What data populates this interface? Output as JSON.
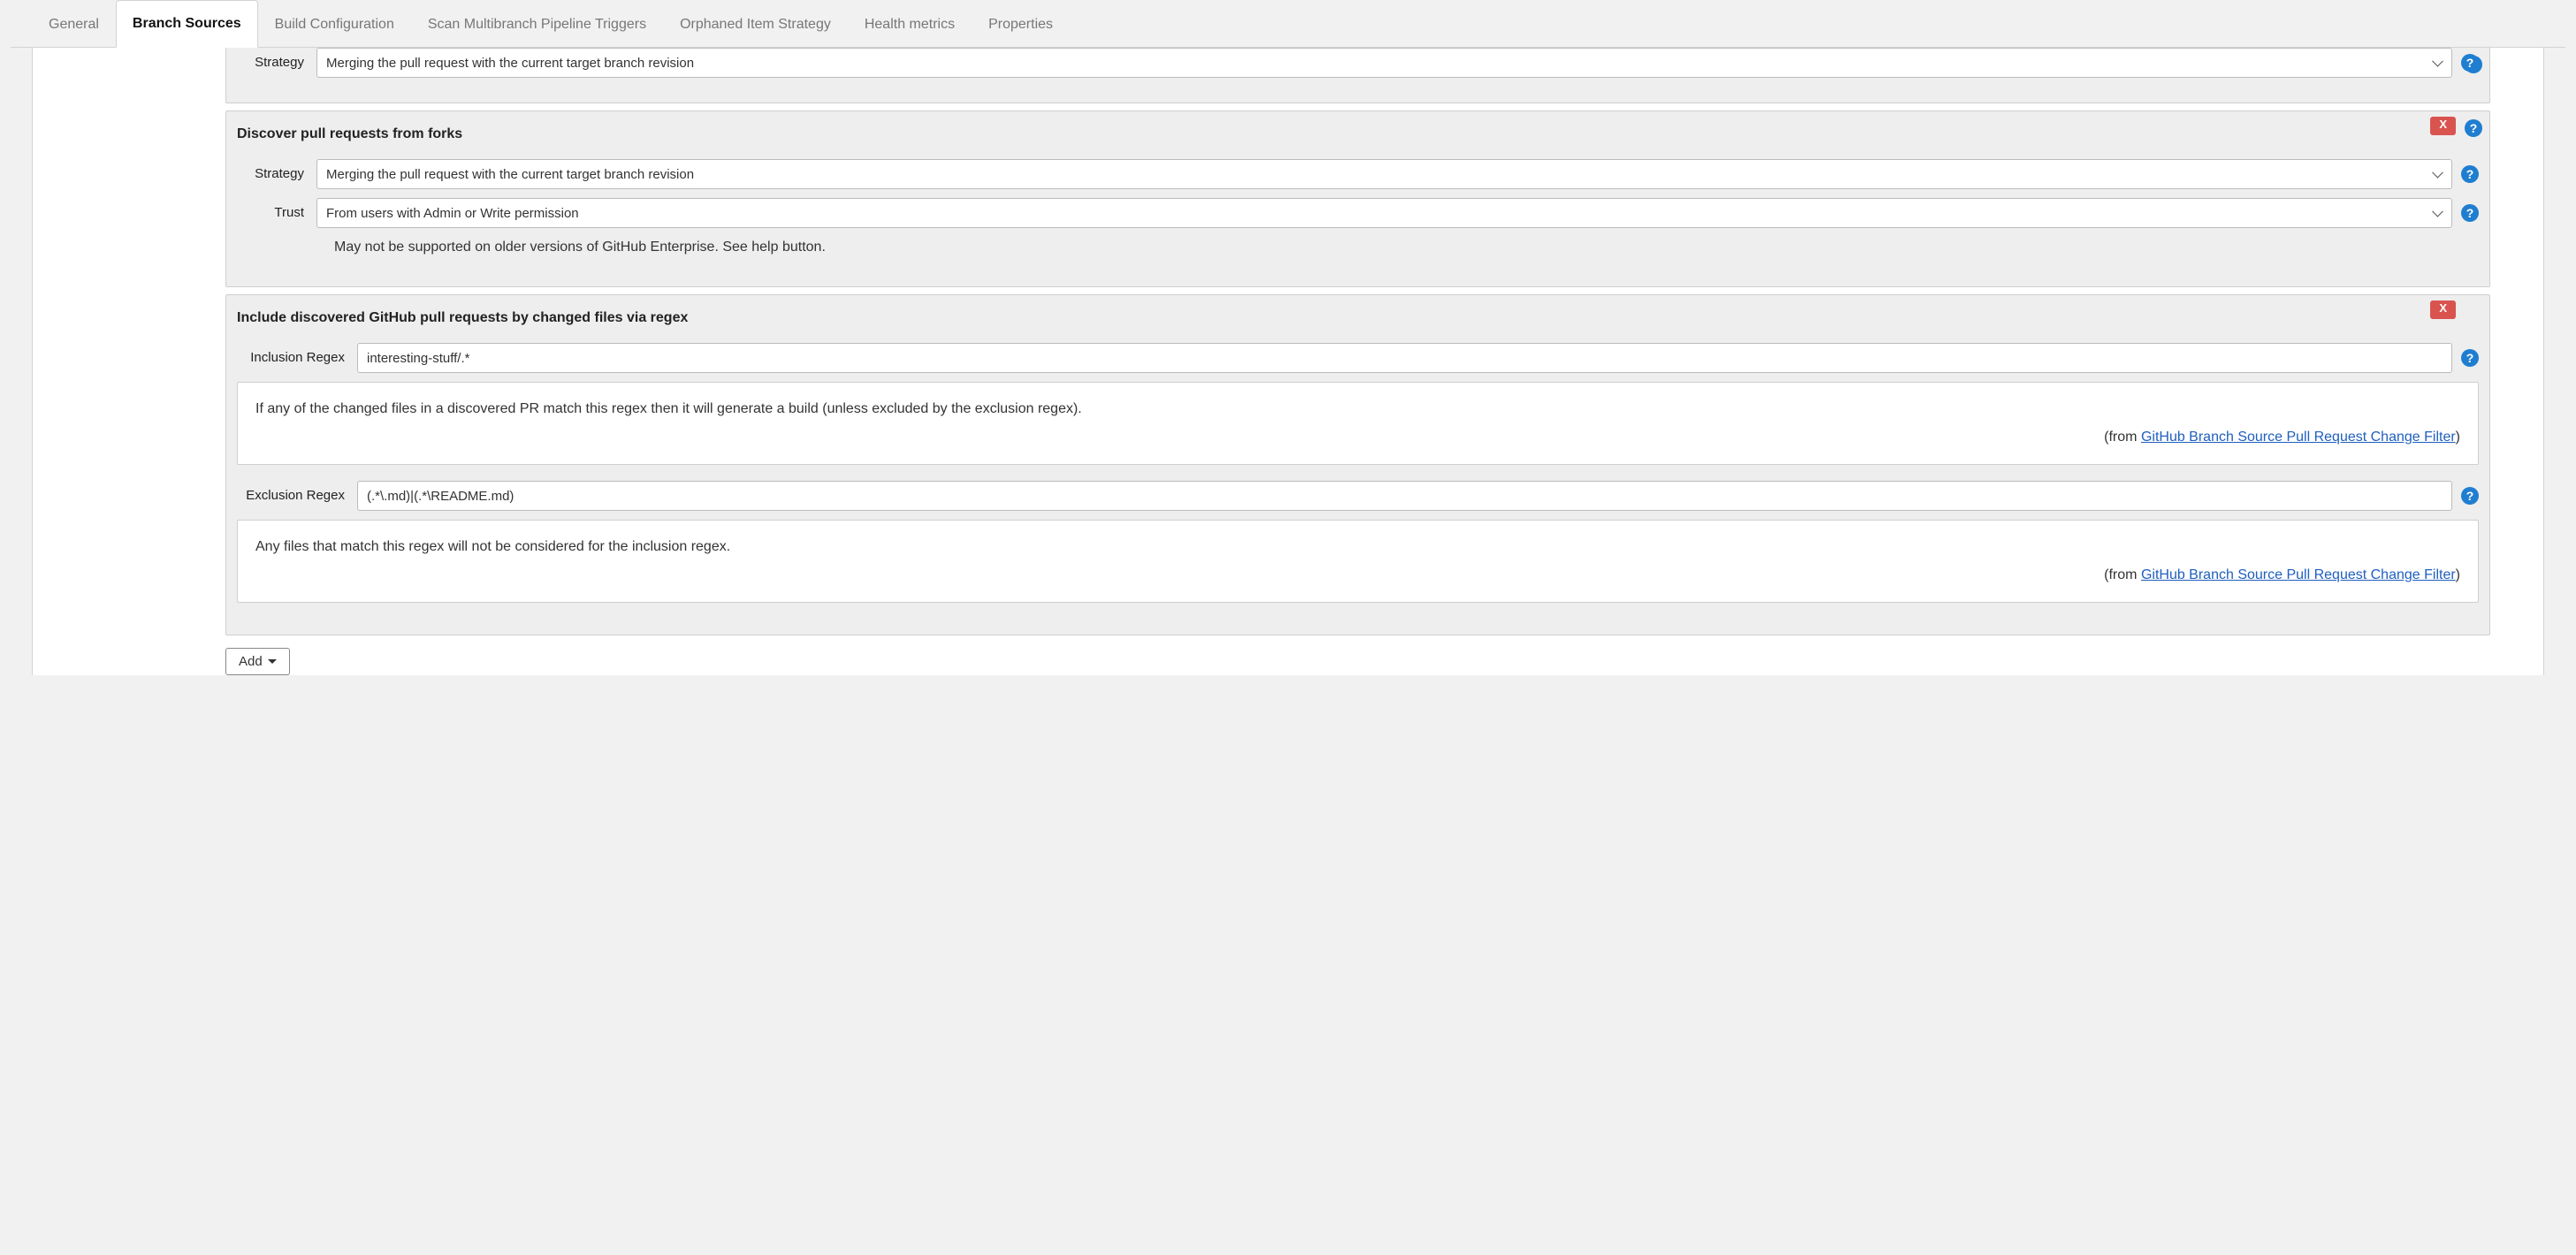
{
  "tabs": [
    {
      "label": "General"
    },
    {
      "label": "Branch Sources"
    },
    {
      "label": "Build Configuration"
    },
    {
      "label": "Scan Multibranch Pipeline Triggers"
    },
    {
      "label": "Orphaned Item Strategy"
    },
    {
      "label": "Health metrics"
    },
    {
      "label": "Properties"
    }
  ],
  "active_tab_index": 1,
  "section_top": {
    "labels": {
      "strategy": "Strategy"
    },
    "strategy_value": "Merging the pull request with the current target branch revision"
  },
  "section_forks": {
    "title": "Discover pull requests from forks",
    "labels": {
      "strategy": "Strategy",
      "trust": "Trust"
    },
    "strategy_value": "Merging the pull request with the current target branch revision",
    "trust_value": "From users with Admin or Write permission",
    "note": "May not be supported on older versions of GitHub Enterprise. See help button.",
    "remove": "X"
  },
  "section_regex": {
    "title": "Include discovered GitHub pull requests by changed files via regex",
    "labels": {
      "inclusion": "Inclusion Regex",
      "exclusion": "Exclusion Regex"
    },
    "inclusion_value": "interesting-stuff/.*",
    "exclusion_value": "(.*\\.md)|(.*\\README.md)",
    "help_inclusion": "If any of the changed files in a discovered PR match this regex then it will generate a build (unless excluded by the exclusion regex).",
    "help_exclusion": "Any files that match this regex will not be considered for the inclusion regex.",
    "help_from_prefix": "(from ",
    "help_from_link": "GitHub Branch Source Pull Request Change Filter",
    "help_from_suffix": ")",
    "remove": "X"
  },
  "add_button": "Add",
  "help_glyph": "?"
}
